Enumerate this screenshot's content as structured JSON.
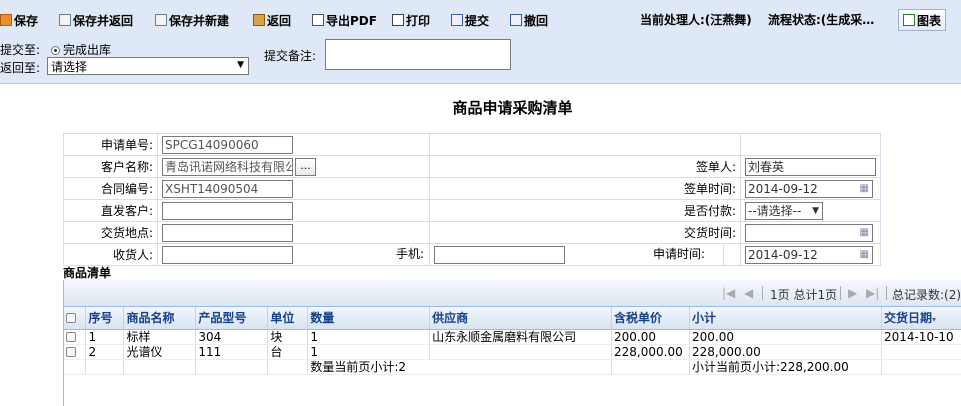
{
  "toolbar": {
    "save": "保存",
    "save_return": "保存并返回",
    "save_new": "保存并新建",
    "back": "返回",
    "export_pdf": "导出PDF",
    "print": "打印",
    "submit": "提交",
    "recall": "撤回",
    "handler": "当前处理人:(汪燕舞)",
    "flow_status": "流程状态:(生成采…",
    "chart": "图表"
  },
  "submit_panel": {
    "submit_to_label": "提交至:",
    "submit_to_option": "完成出库",
    "return_to_label": "返回至:",
    "return_to_value": "请选择",
    "note_label": "提交备注:",
    "note_value": ""
  },
  "page_title": "商品申请采购清单",
  "form": {
    "apply_no_label": "申请单号:",
    "apply_no": "SPCG14090060",
    "customer_label": "客户名称:",
    "customer": "青岛讯诺网络科技有限公",
    "customer_btn": "...",
    "contract_label": "合同编号:",
    "contract": "XSHT14090504",
    "direct_customer_label": "直发客户:",
    "direct_customer": "",
    "delivery_place_label": "交货地点:",
    "delivery_place": "",
    "receiver_label": "收货人:",
    "receiver": "",
    "phone_label": "手机:",
    "phone": "",
    "signer_label": "签单人:",
    "signer": "刘春英",
    "sign_time_label": "签单时间:",
    "sign_time": "2014-09-12",
    "paid_label": "是否付款:",
    "paid": "--请选择--",
    "delivery_time_label": "交货时间:",
    "delivery_time": "",
    "apply_time_label": "申请时间:",
    "apply_time": "2014-09-12"
  },
  "goods": {
    "section_title": "商品清单",
    "pager": {
      "page_info": "1页 总计1页",
      "total": "总记录数:(2)"
    },
    "columns": [
      "序号",
      "商品名称",
      "产品型号",
      "单位",
      "数量",
      "供应商",
      "含税单价",
      "小计",
      "交货日期"
    ],
    "rows": [
      [
        "1",
        "标样",
        "304",
        "块",
        "1",
        "山东永顺金属磨料有限公司",
        "200.00",
        "200.00",
        "2014-10-10"
      ],
      [
        "2",
        "光谱仪",
        "111",
        "台",
        "1",
        "",
        "228,000.00",
        "228,000.00",
        ""
      ]
    ],
    "summary": {
      "qty": "数量当前页小计:2",
      "subtotal": "小计当前页小计:228,200.00"
    }
  }
}
